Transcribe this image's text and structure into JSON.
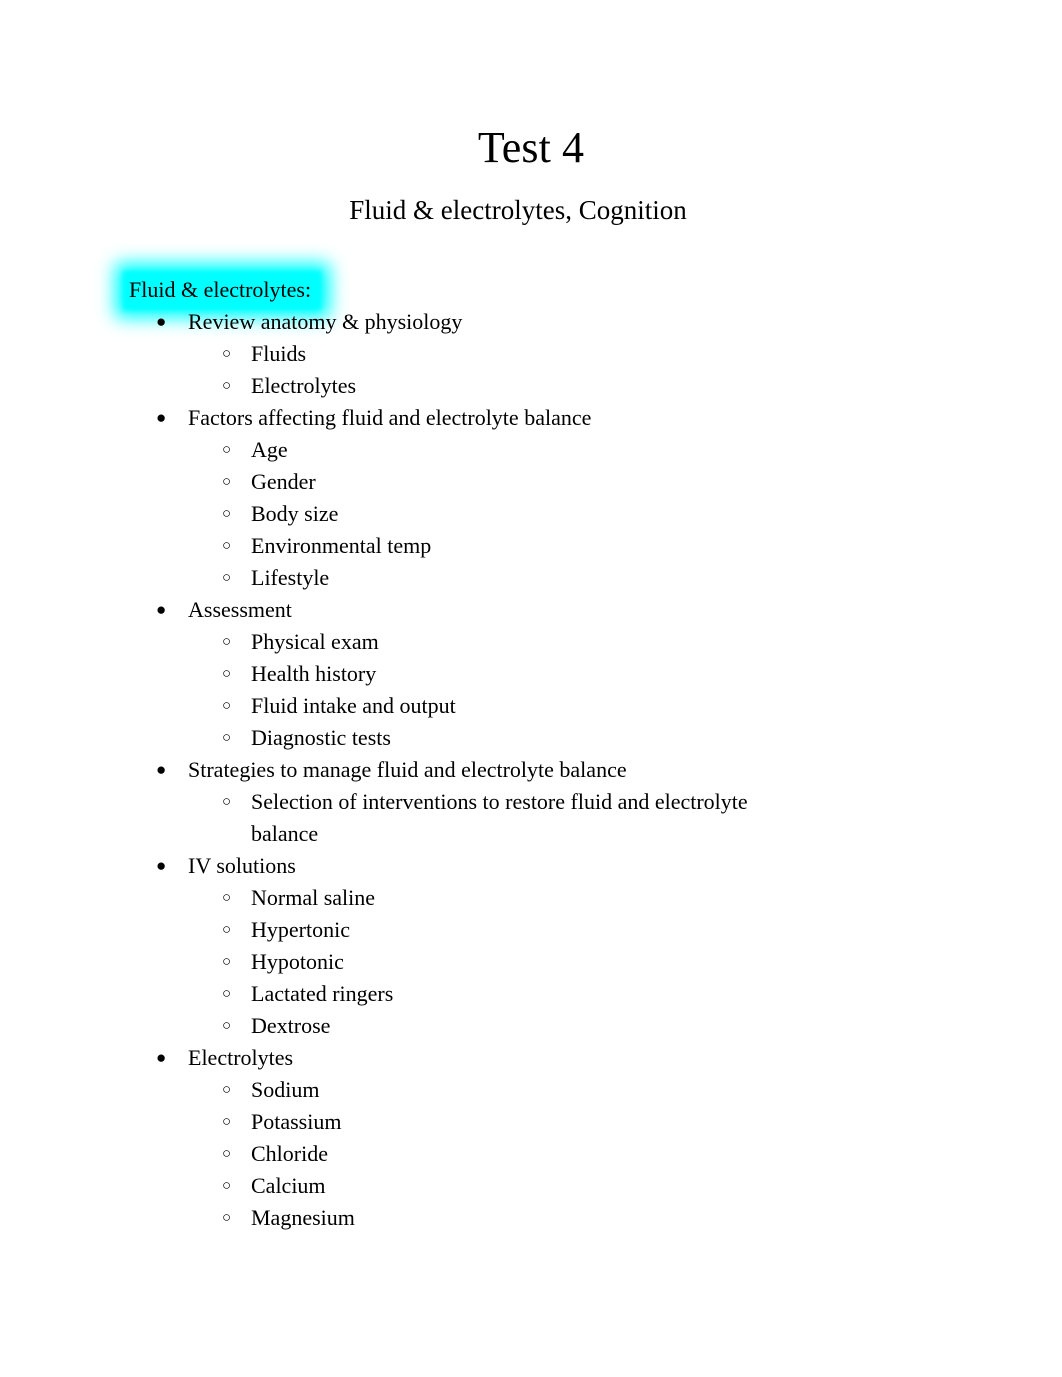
{
  "document": {
    "title": "Test 4",
    "subtitle": "Fluid & electrolytes, Cognition"
  },
  "highlight": {
    "color": "#00ffff",
    "name": "cyan-highlight"
  },
  "sections": [
    {
      "heading": "Fluid & electrolytes:",
      "highlighted": true,
      "items": [
        {
          "level": 1,
          "marker": "●",
          "text": "Review anatomy & physiology"
        },
        {
          "level": 2,
          "marker": "○",
          "text": "Fluids"
        },
        {
          "level": 2,
          "marker": "○",
          "text": "Electrolytes"
        },
        {
          "level": 1,
          "marker": "●",
          "text": "Factors affecting fluid and electrolyte balance"
        },
        {
          "level": 2,
          "marker": "○",
          "text": "Age"
        },
        {
          "level": 2,
          "marker": "○",
          "text": "Gender"
        },
        {
          "level": 2,
          "marker": "○",
          "text": "Body size"
        },
        {
          "level": 2,
          "marker": "○",
          "text": "Environmental temp"
        },
        {
          "level": 2,
          "marker": "○",
          "text": "Lifestyle"
        },
        {
          "level": 1,
          "marker": "●",
          "text": "Assessment"
        },
        {
          "level": 2,
          "marker": "○",
          "text": "Physical exam"
        },
        {
          "level": 2,
          "marker": "○",
          "text": "Health history"
        },
        {
          "level": 2,
          "marker": "○",
          "text": "Fluid intake and output"
        },
        {
          "level": 2,
          "marker": "○",
          "text": "Diagnostic tests"
        },
        {
          "level": 1,
          "marker": "●",
          "text": "Strategies to manage fluid and electrolyte balance"
        },
        {
          "level": 2,
          "marker": "○",
          "text": "Selection of interventions to restore fluid and electrolyte balance"
        },
        {
          "level": 1,
          "marker": "●",
          "text": "IV solutions"
        },
        {
          "level": 2,
          "marker": "○",
          "text": "Normal saline"
        },
        {
          "level": 2,
          "marker": "○",
          "text": "Hypertonic"
        },
        {
          "level": 2,
          "marker": "○",
          "text": "Hypotonic"
        },
        {
          "level": 2,
          "marker": "○",
          "text": "Lactated ringers"
        },
        {
          "level": 2,
          "marker": "○",
          "text": "Dextrose"
        },
        {
          "level": 1,
          "marker": "●",
          "text": "Electrolytes"
        },
        {
          "level": 2,
          "marker": "○",
          "text": "Sodium"
        },
        {
          "level": 2,
          "marker": "○",
          "text": "Potassium"
        },
        {
          "level": 2,
          "marker": "○",
          "text": "Chloride"
        },
        {
          "level": 2,
          "marker": "○",
          "text": "Calcium"
        },
        {
          "level": 2,
          "marker": "○",
          "text": "Magnesium"
        }
      ]
    }
  ]
}
